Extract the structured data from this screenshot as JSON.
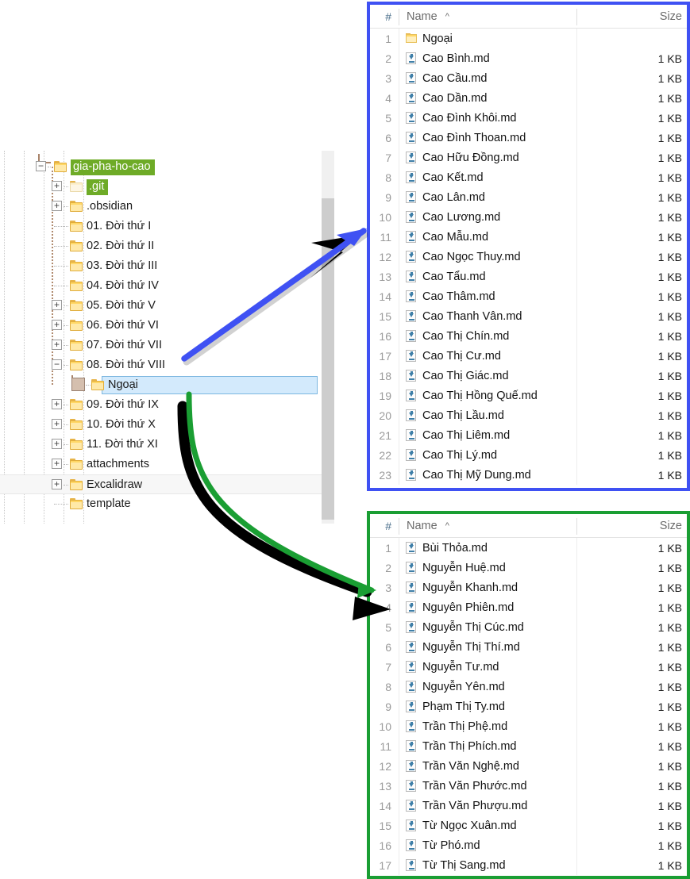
{
  "tree": {
    "panel_name": "folder-tree",
    "items": [
      {
        "label": "gia-pha-ho-cao",
        "depth": 0,
        "expander": "minus",
        "selected_green": true,
        "folder": "normal"
      },
      {
        "label": ".git",
        "depth": 1,
        "expander": "plus",
        "selected_green": true,
        "folder": "pale"
      },
      {
        "label": ".obsidian",
        "depth": 1,
        "expander": "plus",
        "selected_green": false,
        "folder": "normal"
      },
      {
        "label": "01. Đời thứ I",
        "depth": 1,
        "expander": "none",
        "selected_green": false,
        "folder": "normal"
      },
      {
        "label": "02. Đời thứ II",
        "depth": 1,
        "expander": "none",
        "selected_green": false,
        "folder": "normal"
      },
      {
        "label": "03. Đời thứ III",
        "depth": 1,
        "expander": "none",
        "selected_green": false,
        "folder": "normal"
      },
      {
        "label": "04. Đời thứ IV",
        "depth": 1,
        "expander": "none",
        "selected_green": false,
        "folder": "normal"
      },
      {
        "label": "05. Đời thứ V",
        "depth": 1,
        "expander": "plus",
        "selected_green": false,
        "folder": "normal"
      },
      {
        "label": "06. Đời thứ VI",
        "depth": 1,
        "expander": "plus",
        "selected_green": false,
        "folder": "normal"
      },
      {
        "label": "07. Đời thứ VII",
        "depth": 1,
        "expander": "plus",
        "selected_green": false,
        "folder": "normal"
      },
      {
        "label": "08. Đời thứ VIII",
        "depth": 1,
        "expander": "minus",
        "selected_green": false,
        "folder": "normal"
      },
      {
        "label": "Ngoại",
        "depth": 2,
        "expander": "bigblank",
        "selected_blue": true,
        "folder": "normal"
      },
      {
        "label": "09. Đời thứ IX",
        "depth": 1,
        "expander": "plus",
        "selected_green": false,
        "folder": "normal"
      },
      {
        "label": "10. Đời thứ X",
        "depth": 1,
        "expander": "plus",
        "selected_green": false,
        "folder": "normal"
      },
      {
        "label": "11. Đời thứ XI",
        "depth": 1,
        "expander": "plus",
        "selected_green": false,
        "folder": "normal"
      },
      {
        "label": "attachments",
        "depth": 1,
        "expander": "plus",
        "selected_green": false,
        "folder": "normal"
      },
      {
        "label": "Excalidraw",
        "depth": 1,
        "expander": "plus",
        "selected_green": false,
        "folder": "normal",
        "hovered": true
      },
      {
        "label": "template",
        "depth": 1,
        "expander": "none",
        "selected_green": false,
        "folder": "normal"
      }
    ]
  },
  "list_blue": {
    "panel_name": "file-list-ngoai-parent",
    "border_color": "#3f51f3",
    "columns": {
      "num": "#",
      "name": "Name",
      "sort_caret": "^",
      "size": "Size"
    },
    "rows": [
      {
        "num": "1",
        "name": "Ngoại",
        "size": "",
        "icon": "folder-icon"
      },
      {
        "num": "2",
        "name": "Cao Bình.md",
        "size": "1 KB",
        "icon": "markdown-file-icon"
      },
      {
        "num": "3",
        "name": "Cao Cầu.md",
        "size": "1 KB",
        "icon": "markdown-file-icon"
      },
      {
        "num": "4",
        "name": "Cao Dần.md",
        "size": "1 KB",
        "icon": "markdown-file-icon"
      },
      {
        "num": "5",
        "name": "Cao Đình Khôi.md",
        "size": "1 KB",
        "icon": "markdown-file-icon"
      },
      {
        "num": "6",
        "name": "Cao Đình Thoan.md",
        "size": "1 KB",
        "icon": "markdown-file-icon"
      },
      {
        "num": "7",
        "name": "Cao Hữu Đồng.md",
        "size": "1 KB",
        "icon": "markdown-file-icon"
      },
      {
        "num": "8",
        "name": "Cao Kết.md",
        "size": "1 KB",
        "icon": "markdown-file-icon"
      },
      {
        "num": "9",
        "name": "Cao Lân.md",
        "size": "1 KB",
        "icon": "markdown-file-icon"
      },
      {
        "num": "10",
        "name": "Cao Lương.md",
        "size": "1 KB",
        "icon": "markdown-file-icon"
      },
      {
        "num": "11",
        "name": "Cao Mẫu.md",
        "size": "1 KB",
        "icon": "markdown-file-icon"
      },
      {
        "num": "12",
        "name": "Cao Ngọc Thuy.md",
        "size": "1 KB",
        "icon": "markdown-file-icon"
      },
      {
        "num": "13",
        "name": "Cao Tẩu.md",
        "size": "1 KB",
        "icon": "markdown-file-icon"
      },
      {
        "num": "14",
        "name": "Cao Thâm.md",
        "size": "1 KB",
        "icon": "markdown-file-icon"
      },
      {
        "num": "15",
        "name": "Cao Thanh Vân.md",
        "size": "1 KB",
        "icon": "markdown-file-icon"
      },
      {
        "num": "16",
        "name": "Cao Thị Chín.md",
        "size": "1 KB",
        "icon": "markdown-file-icon"
      },
      {
        "num": "17",
        "name": "Cao Thị Cư.md",
        "size": "1 KB",
        "icon": "markdown-file-icon"
      },
      {
        "num": "18",
        "name": "Cao Thị Giác.md",
        "size": "1 KB",
        "icon": "markdown-file-icon"
      },
      {
        "num": "19",
        "name": "Cao Thị Hồng Quế.md",
        "size": "1 KB",
        "icon": "markdown-file-icon"
      },
      {
        "num": "20",
        "name": "Cao Thị Lầu.md",
        "size": "1 KB",
        "icon": "markdown-file-icon"
      },
      {
        "num": "21",
        "name": "Cao Thị Liêm.md",
        "size": "1 KB",
        "icon": "markdown-file-icon"
      },
      {
        "num": "22",
        "name": "Cao Thị Lý.md",
        "size": "1 KB",
        "icon": "markdown-file-icon"
      },
      {
        "num": "23",
        "name": "Cao Thị Mỹ Dung.md",
        "size": "1 KB",
        "icon": "markdown-file-icon"
      }
    ]
  },
  "list_green": {
    "panel_name": "file-list-ngoai",
    "border_color": "#1a9e33",
    "columns": {
      "num": "#",
      "name": "Name",
      "sort_caret": "^",
      "size": "Size"
    },
    "rows": [
      {
        "num": "1",
        "name": "Bùi Thỏa.md",
        "size": "1 KB",
        "icon": "markdown-file-icon"
      },
      {
        "num": "2",
        "name": "Nguyễn Huệ.md",
        "size": "1 KB",
        "icon": "markdown-file-icon"
      },
      {
        "num": "3",
        "name": "Nguyễn Khanh.md",
        "size": "1 KB",
        "icon": "markdown-file-icon"
      },
      {
        "num": "4",
        "name": "Nguyên Phiên.md",
        "size": "1 KB",
        "icon": "markdown-file-icon"
      },
      {
        "num": "5",
        "name": "Nguyễn Thị Cúc.md",
        "size": "1 KB",
        "icon": "markdown-file-icon"
      },
      {
        "num": "6",
        "name": "Nguyễn Thị Thí.md",
        "size": "1 KB",
        "icon": "markdown-file-icon"
      },
      {
        "num": "7",
        "name": "Nguyễn Tư.md",
        "size": "1 KB",
        "icon": "markdown-file-icon"
      },
      {
        "num": "8",
        "name": "Nguyễn Yên.md",
        "size": "1 KB",
        "icon": "markdown-file-icon"
      },
      {
        "num": "9",
        "name": "Phạm Thị Ty.md",
        "size": "1 KB",
        "icon": "markdown-file-icon"
      },
      {
        "num": "10",
        "name": "Trần Thị Phệ.md",
        "size": "1 KB",
        "icon": "markdown-file-icon"
      },
      {
        "num": "11",
        "name": "Trần Thị Phích.md",
        "size": "1 KB",
        "icon": "markdown-file-icon"
      },
      {
        "num": "12",
        "name": "Trần Văn Nghệ.md",
        "size": "1 KB",
        "icon": "markdown-file-icon"
      },
      {
        "num": "13",
        "name": "Trần Văn Phước.md",
        "size": "1 KB",
        "icon": "markdown-file-icon"
      },
      {
        "num": "14",
        "name": "Trần Văn Phượu.md",
        "size": "1 KB",
        "icon": "markdown-file-icon"
      },
      {
        "num": "15",
        "name": "Từ Ngọc Xuân.md",
        "size": "1 KB",
        "icon": "markdown-file-icon"
      },
      {
        "num": "16",
        "name": "Từ Phó.md",
        "size": "1 KB",
        "icon": "markdown-file-icon"
      },
      {
        "num": "17",
        "name": "Từ Thị Sang.md",
        "size": "1 KB",
        "icon": "markdown-file-icon"
      }
    ]
  },
  "annotations": {
    "blue_arrow": {
      "name": "blue-annotation-arrow",
      "color": "#3f51f3"
    },
    "green_arrow": {
      "name": "green-annotation-arrow",
      "color": "#1a9e33"
    }
  }
}
